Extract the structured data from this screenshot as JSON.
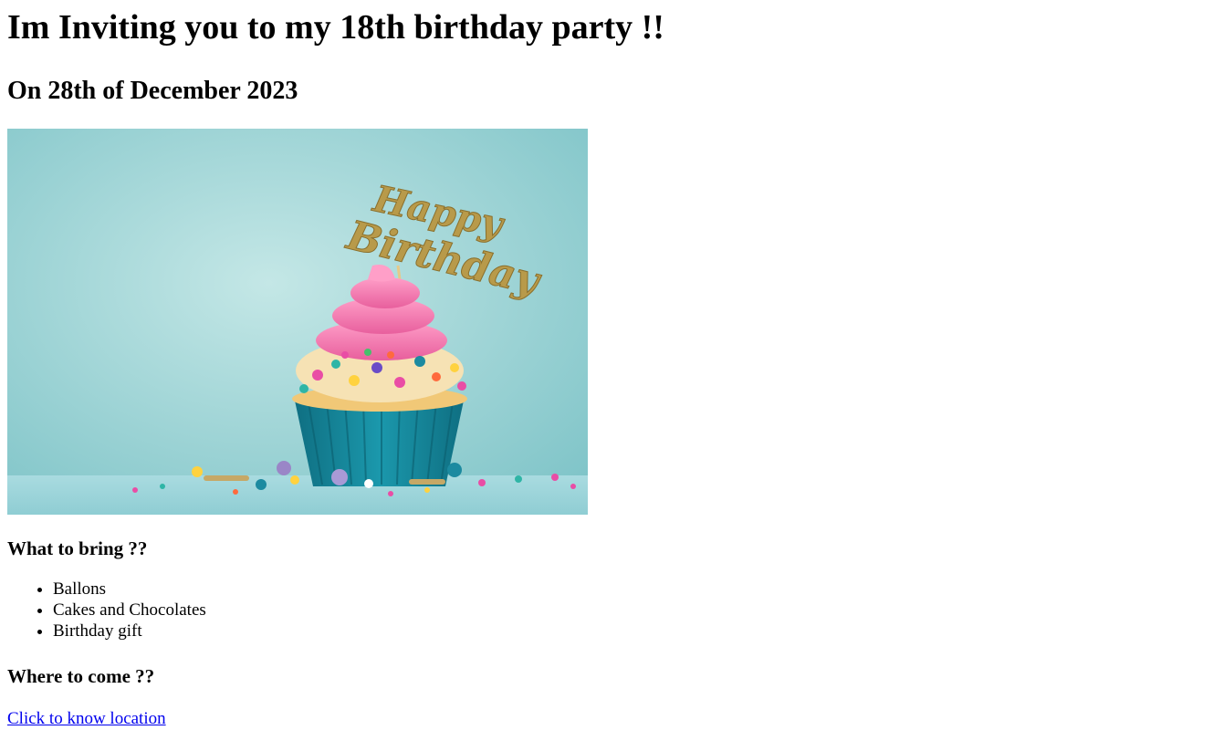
{
  "heading": "Im Inviting you to my 18th birthday party !!",
  "date": "On 28th of December 2023",
  "image": {
    "icon": "birthday-cupcake-photo",
    "topper_text": "Happy Birthday",
    "colors": {
      "background": "#9fd6d6",
      "frosting": "#f27fb0",
      "liner": "#1b8fa2",
      "topper": "#b89a4a"
    }
  },
  "bring": {
    "title": "What to bring ??",
    "items": [
      "Ballons",
      "Cakes and Chocolates",
      "Birthday gift"
    ]
  },
  "where": {
    "title": "Where to come ??",
    "link_text": "Click to know location"
  }
}
